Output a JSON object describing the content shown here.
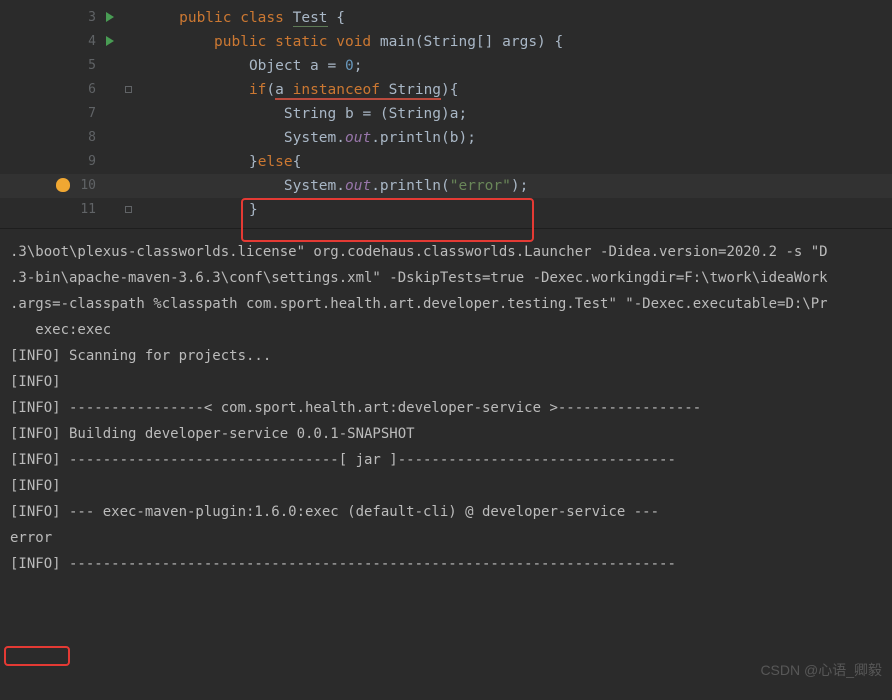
{
  "code": {
    "lines": [
      {
        "num": "3",
        "run": true,
        "indent": 1,
        "tokens": [
          {
            "t": "public ",
            "c": "kw"
          },
          {
            "t": "class ",
            "c": "kw"
          },
          {
            "t": "Test",
            "c": "ident",
            "ul": "green"
          },
          {
            "t": " {",
            "c": "ident"
          }
        ]
      },
      {
        "num": "4",
        "run": true,
        "indent": 2,
        "tokens": [
          {
            "t": "public static void ",
            "c": "kw"
          },
          {
            "t": "main",
            "c": "method"
          },
          {
            "t": "(String[] args) {",
            "c": "ident"
          }
        ]
      },
      {
        "num": "5",
        "indent": 3,
        "tokens": [
          {
            "t": "Object a = ",
            "c": "ident"
          },
          {
            "t": "0",
            "c": "num"
          },
          {
            "t": ";",
            "c": "ident"
          }
        ]
      },
      {
        "num": "6",
        "indent": 3,
        "fold": true,
        "tokens": [
          {
            "t": "if",
            "c": "kw"
          },
          {
            "t": "(",
            "c": "ident"
          },
          {
            "t": "a ",
            "c": "ident",
            "ul": "red"
          },
          {
            "t": "instanceof ",
            "c": "kw",
            "ul": "red"
          },
          {
            "t": "String",
            "c": "ident",
            "ul": "red"
          },
          {
            "t": "){",
            "c": "ident"
          }
        ]
      },
      {
        "num": "7",
        "indent": 4,
        "tokens": [
          {
            "t": "String b = (String)a;",
            "c": "ident"
          }
        ]
      },
      {
        "num": "8",
        "indent": 4,
        "tokens": [
          {
            "t": "System.",
            "c": "ident"
          },
          {
            "t": "out",
            "c": "field"
          },
          {
            "t": ".println(b);",
            "c": "ident"
          }
        ]
      },
      {
        "num": "9",
        "indent": 3,
        "tokens": [
          {
            "t": "}",
            "c": "ident"
          },
          {
            "t": "else",
            "c": "kw"
          },
          {
            "t": "{",
            "c": "ident"
          }
        ]
      },
      {
        "num": "10",
        "hl": true,
        "bulb": true,
        "indent": 4,
        "tokens": [
          {
            "t": "System.",
            "c": "ident"
          },
          {
            "t": "out",
            "c": "field"
          },
          {
            "t": ".println(",
            "c": "ident"
          },
          {
            "t": "\"error\"",
            "c": "str"
          },
          {
            "t": ");",
            "c": "ident"
          }
        ]
      },
      {
        "num": "11",
        "indent": 3,
        "fold": true,
        "tokens": [
          {
            "t": "}",
            "c": "ident"
          }
        ]
      }
    ]
  },
  "terminal_prefix": ".3\\boot\\plexus-classworlds.license\" org.codehaus.classworlds.Launcher -Didea.version=2020.2 -s \"D\n.3-bin\\apache-maven-3.6.3\\conf\\settings.xml\" -DskipTests=true -Dexec.workingdir=F:\\twork\\ideaWork\n.args=-classpath %classpath com.sport.health.art.developer.testing.Test\" \"-Dexec.executable=D:\\Pr\n   exec:exec",
  "terminal_lines": [
    "[INFO] Scanning for projects...",
    "[INFO]",
    "[INFO] ----------------< com.sport.health.art:developer-service >-----------------",
    "[INFO] Building developer-service 0.0.1-SNAPSHOT",
    "[INFO] --------------------------------[ jar ]---------------------------------",
    "[INFO]",
    "[INFO] --- exec-maven-plugin:1.6.0:exec (default-cli) @ developer-service ---"
  ],
  "terminal_error": "error",
  "terminal_after": "[INFO] ------------------------------------------------------------------------",
  "watermark": "CSDN @心语_卿毅"
}
